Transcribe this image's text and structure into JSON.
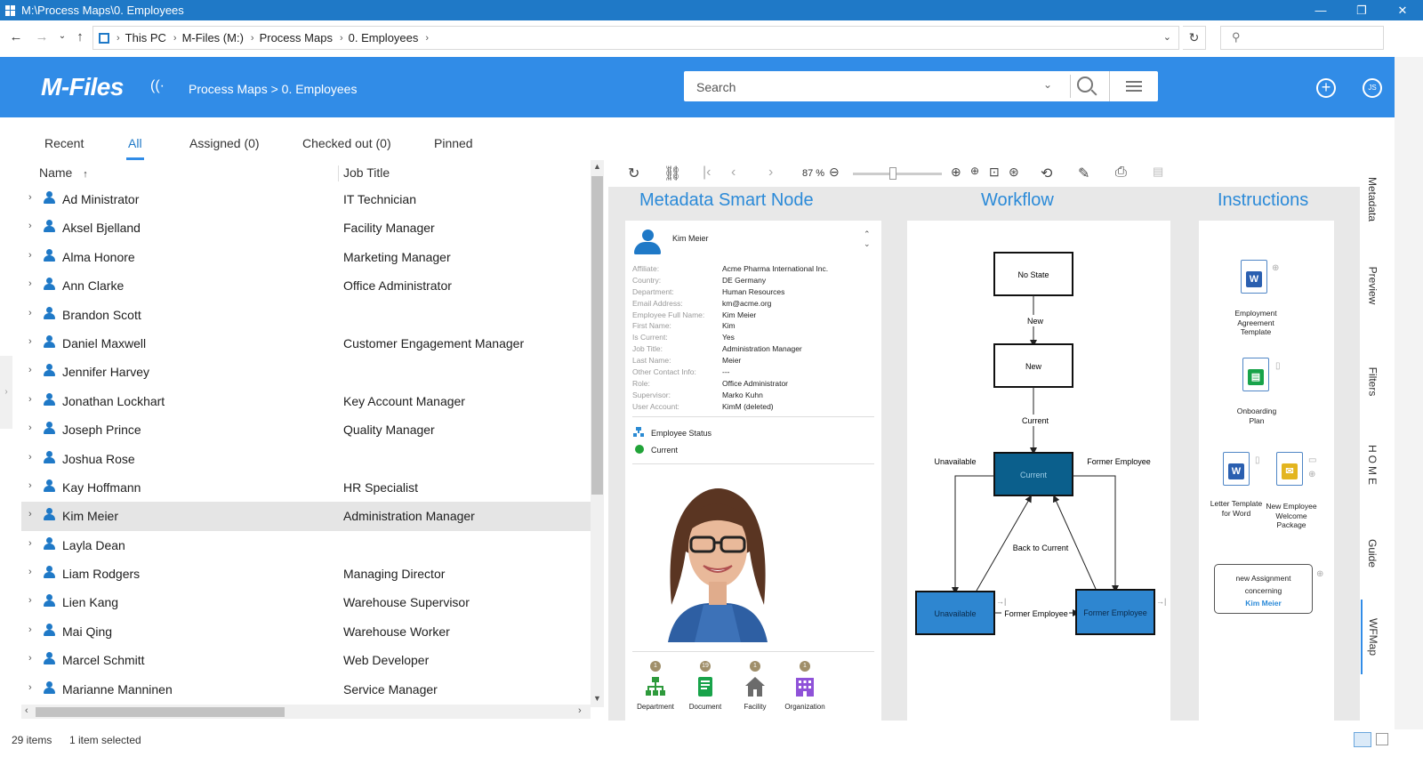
{
  "window": {
    "title": "M:\\Process Maps\\0. Employees",
    "min": "—",
    "max": "❐",
    "close": "✕"
  },
  "addressbar": {
    "crumbs": [
      "This PC",
      "M-Files (M:)",
      "Process Maps",
      "0. Employees"
    ]
  },
  "header": {
    "logo": "M-Files",
    "path": "Process Maps > 0. Employees",
    "search_placeholder": "Search",
    "avatar_initials": "JS"
  },
  "tabs": [
    "Recent",
    "All",
    "Assigned (0)",
    "Checked out (0)",
    "Pinned"
  ],
  "active_tab": "All",
  "list": {
    "col_name": "Name",
    "col_job": "Job Title",
    "sort_indicator": "↑",
    "rows": [
      {
        "name": "Ad Ministrator",
        "job": "IT Technician"
      },
      {
        "name": "Aksel Bjelland",
        "job": "Facility Manager"
      },
      {
        "name": "Alma Honore",
        "job": "Marketing Manager"
      },
      {
        "name": "Ann Clarke",
        "job": "Office Administrator"
      },
      {
        "name": "Brandon Scott",
        "job": ""
      },
      {
        "name": "Daniel Maxwell",
        "job": "Customer Engagement Manager"
      },
      {
        "name": "Jennifer Harvey",
        "job": ""
      },
      {
        "name": "Jonathan Lockhart",
        "job": "Key Account Manager"
      },
      {
        "name": "Joseph Prince",
        "job": "Quality Manager"
      },
      {
        "name": "Joshua Rose",
        "job": ""
      },
      {
        "name": "Kay Hoffmann",
        "job": "HR Specialist"
      },
      {
        "name": "Kim Meier",
        "job": "Administration Manager",
        "selected": true
      },
      {
        "name": "Layla Dean",
        "job": ""
      },
      {
        "name": "Liam Rodgers",
        "job": "Managing Director"
      },
      {
        "name": "Lien Kang",
        "job": "Warehouse Supervisor"
      },
      {
        "name": "Mai Qing",
        "job": "Warehouse Worker"
      },
      {
        "name": "Marcel Schmitt",
        "job": "Web Developer"
      },
      {
        "name": "Marianne Manninen",
        "job": "Service Manager"
      }
    ]
  },
  "toolbar": {
    "zoom": "87 %",
    "zoom_slider_level": 0.45
  },
  "sections": {
    "metadata": "Metadata Smart Node",
    "workflow": "Workflow",
    "instructions": "Instructions"
  },
  "metadata_card": {
    "name": "Kim Meier",
    "properties": [
      {
        "k": "Affiliate:",
        "v": "Acme Pharma International Inc."
      },
      {
        "k": "Country:",
        "v": "DE Germany"
      },
      {
        "k": "Department:",
        "v": "Human Resources"
      },
      {
        "k": "Email Address:",
        "v": "km@acme.org"
      },
      {
        "k": "Employee Full Name:",
        "v": "Kim Meier"
      },
      {
        "k": "First Name:",
        "v": "Kim"
      },
      {
        "k": "Is Current:",
        "v": "Yes"
      },
      {
        "k": "Job Title:",
        "v": "Administration Manager"
      },
      {
        "k": "Last Name:",
        "v": "Meier"
      },
      {
        "k": "Other Contact Info:",
        "v": "---"
      },
      {
        "k": "Role:",
        "v": "Office Administrator"
      },
      {
        "k": "Supervisor:",
        "v": "Marko Kuhn"
      },
      {
        "k": "User Account:",
        "v": "KimM (deleted)"
      }
    ],
    "status_label": "Employee Status",
    "status_value": "Current",
    "relations": [
      {
        "count": "1",
        "label": "Department"
      },
      {
        "count": "19",
        "label": "Document"
      },
      {
        "count": "1",
        "label": "Facility"
      },
      {
        "count": "1",
        "label": "Organization"
      }
    ]
  },
  "workflow": {
    "states": {
      "no_state": "No State",
      "new": "New",
      "current": "Current",
      "unavailable": "Unavailable",
      "former": "Former Employee"
    },
    "transitions": {
      "to_new": "New",
      "to_current": "Current",
      "to_unavailable": "Unavailable",
      "to_former": "Former Employee",
      "back": "Back to Current",
      "unavail_to_former": "Former Employee"
    },
    "colors": {
      "current": "#0b5f8c",
      "other": "#2e86d0"
    }
  },
  "instructions": {
    "items": [
      {
        "label": "Employment Agreement Template",
        "icon": "word-icon"
      },
      {
        "label": "Onboarding Plan",
        "icon": "green-doc-icon"
      },
      {
        "label": "Letter Template for Word",
        "icon": "word-icon"
      },
      {
        "label": "New Employee Welcome Package",
        "icon": "mail-doc-icon"
      }
    ],
    "assignment": {
      "line1": "new Assignment",
      "line2": "concerning",
      "who": "Kim Meier"
    }
  },
  "vtabs": [
    "Metadata",
    "Preview",
    "Filters",
    "HOME",
    "Guide",
    "WFMap"
  ],
  "statusbar": {
    "items": "29 items",
    "selected": "1 item selected"
  }
}
